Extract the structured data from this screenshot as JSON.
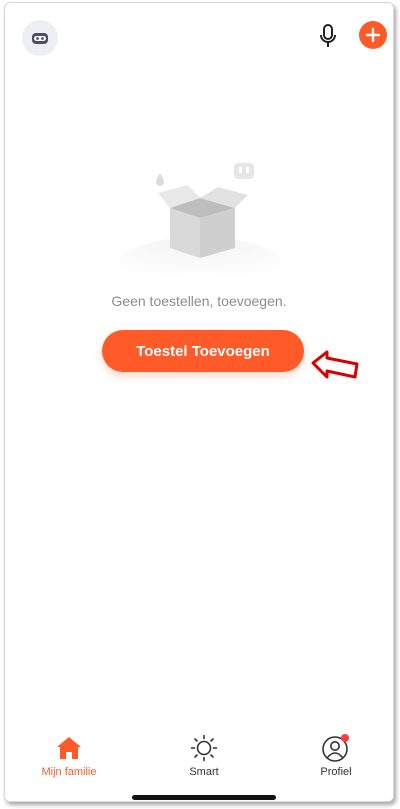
{
  "header": {
    "avatar_icon": "robot-avatar-icon",
    "mic_icon": "microphone-icon",
    "add_icon": "plus-icon"
  },
  "empty_state": {
    "illustration_icon": "empty-box-icon",
    "message": "Geen toestellen, toevoegen.",
    "button_label": "Toestel Toevoegen"
  },
  "bottom_nav": {
    "items": [
      {
        "label": "Mijn familie",
        "icon": "home-icon",
        "active": true
      },
      {
        "label": "Smart",
        "icon": "sun-icon",
        "active": false
      },
      {
        "label": "Profiel",
        "icon": "profile-icon",
        "active": false,
        "badge": true
      }
    ]
  },
  "colors": {
    "accent": "#ff5a28",
    "annotation_arrow": "#d60000",
    "text_secondary": "#8c8c8c",
    "badge": "#ff3b3b"
  }
}
